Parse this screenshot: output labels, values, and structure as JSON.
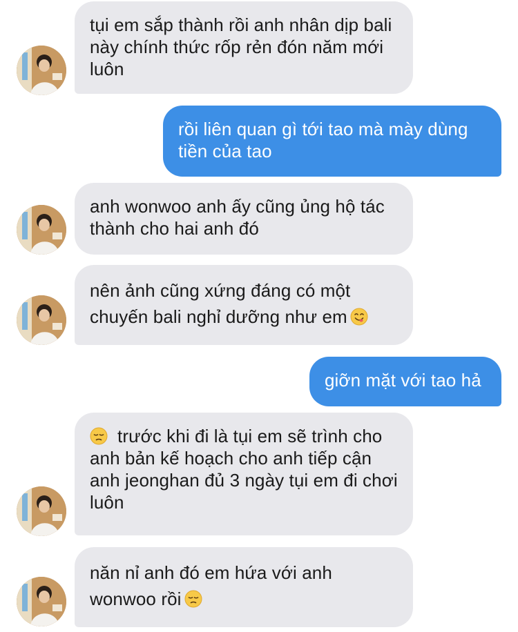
{
  "conversation": {
    "messages": [
      {
        "sender": "them",
        "text": "tụi em sắp thành rồi anh nhân dịp bali này chính thức rốp rẻn đón năm mới luôn"
      },
      {
        "sender": "me",
        "text": "rồi liên quan gì tới tao mà mày dùng tiền của tao"
      },
      {
        "sender": "them",
        "text": "anh wonwoo anh ấy cũng ủng hộ tác thành cho hai anh đó"
      },
      {
        "sender": "them",
        "text": "nên ảnh cũng xứng đáng có một chuyến bali nghỉ dưỡng như em",
        "emoji": "yum-face-icon"
      },
      {
        "sender": "me",
        "text": "giỡn mặt với tao hả"
      },
      {
        "sender": "them",
        "text": "trước khi đi là tụi em sẽ trình cho anh bản kế hoạch cho anh tiếp cận anh jeonghan đủ 3 ngày tụi em đi chơi luôn",
        "lead_emoji": "pensive-face-icon"
      },
      {
        "sender": "them",
        "text": "năn nỉ anh đó em hứa với anh wonwoo rồi",
        "emoji": "pensive-face-icon"
      }
    ]
  },
  "colors": {
    "incoming_bubble": "#e8e8ec",
    "outgoing_bubble": "#3d8fe6",
    "incoming_text": "#1a1a1a",
    "outgoing_text": "#ffffff"
  }
}
